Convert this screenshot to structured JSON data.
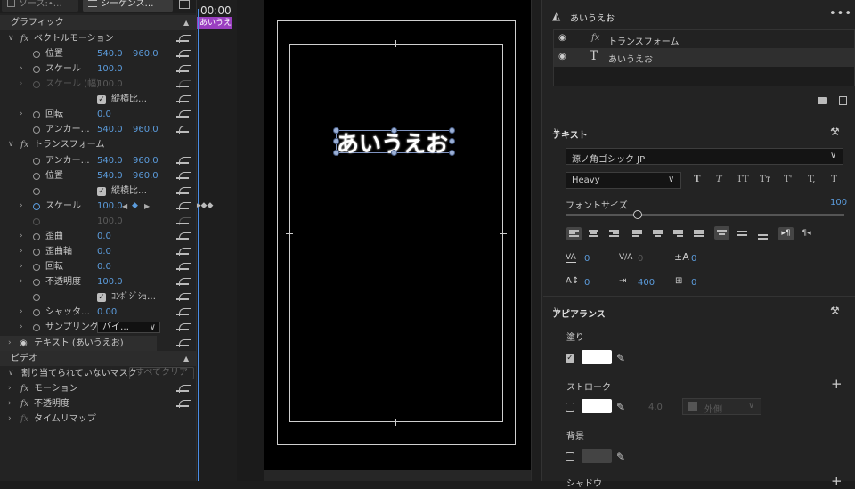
{
  "tabs": {
    "source": "ソース:•…",
    "sequence": "シーケンス…"
  },
  "effects": {
    "group_graphic": "グラフィック",
    "vector_motion": "ベクトルモーション",
    "position_label": "位置",
    "position_x": "540.0",
    "position_y": "960.0",
    "scale_label": "スケール",
    "scale_value": "100.0",
    "scale_width_label": "スケール (幅)",
    "scale_width_value": "100.0",
    "uniform_label": "縦横比…",
    "rotation_label": "回転",
    "rotation_value": "0.0",
    "anchor_label": "アンカー…",
    "anchor_x": "540.0",
    "anchor_y": "960.0",
    "transform": "トランスフォーム",
    "t_anchor_label": "アンカー…",
    "t_anchor_x": "540.0",
    "t_anchor_y": "960.0",
    "t_position_label": "位置",
    "t_position_x": "540.0",
    "t_position_y": "960.0",
    "t_uniform_label": "縦横比…",
    "t_scale_label": "スケール",
    "t_scale_value": "100.0",
    "t_scale2_value": "100.0",
    "skew_label": "歪曲",
    "skew_value": "0.0",
    "skew_axis_label": "歪曲軸",
    "skew_axis_value": "0.0",
    "t_rotation_label": "回転",
    "t_rotation_value": "0.0",
    "opacity_label": "不透明度",
    "opacity_value": "100.0",
    "composite_label": "ｺﾝﾎﾟｼﾞｼｮ…",
    "shutter_label": "シャッタ…",
    "shutter_value": "0.00",
    "sampling_label": "サンプリング",
    "sampling_value": "バイ…",
    "text_layer": "テキスト (あいうえお)",
    "group_video": "ビデオ",
    "mask_label": "割り当てられていないマスク",
    "clear_all": "すべてクリア",
    "motion": "モーション",
    "v_opacity": "不透明度",
    "time_remap": "タイムリマップ"
  },
  "timeline": {
    "timecode": "00:00",
    "clip_label": "あいうえ"
  },
  "program": {
    "text": "あいうえお"
  },
  "right": {
    "title": "あいうえお",
    "layers": [
      {
        "name": "トランスフォーム"
      },
      {
        "name": "あいうえお"
      }
    ],
    "text_section": "テキスト",
    "font_family": "源ノ角ゴシック JP",
    "font_style": "Heavy",
    "style_buttons": [
      "T",
      "T",
      "TT",
      "Tт",
      "T'",
      "T,",
      "T"
    ],
    "font_size_label": "フォントサイズ",
    "font_size_value": "100",
    "font_size_fraction": 0.14,
    "kerning": "0",
    "tracking_va": "0",
    "leading": "0",
    "baseline": "0",
    "tsume": "400",
    "indent": "0",
    "appearance_section": "アピアランス",
    "fill_label": "塗り",
    "fill_color": "#ffffff",
    "stroke_label": "ストローク",
    "stroke_color": "#ffffff",
    "stroke_width": "4.0",
    "stroke_position": "外側",
    "bg_label": "背景",
    "shadow_label": "シャドウ"
  }
}
